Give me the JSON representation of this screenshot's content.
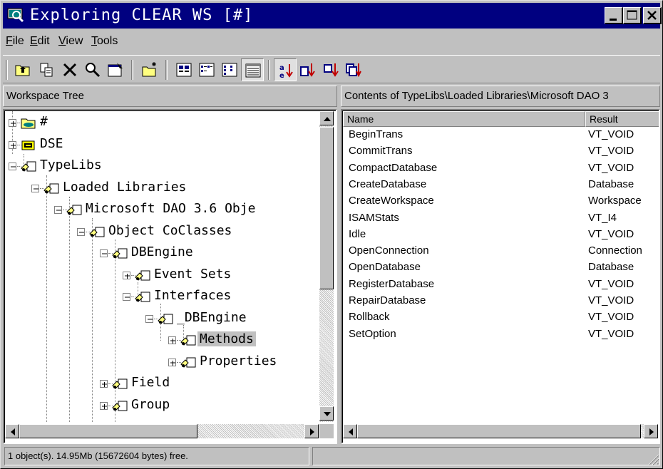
{
  "window": {
    "title": "Exploring CLEAR WS [#]",
    "title_bar_color": "#000080",
    "controls": [
      "minimize-icon",
      "maximize-icon",
      "close-icon"
    ]
  },
  "menu": [
    {
      "label": "File",
      "accel": "F",
      "rest": "ile"
    },
    {
      "label": "Edit",
      "accel": "E",
      "rest": "dit"
    },
    {
      "label": "View",
      "accel": "V",
      "rest": "iew"
    },
    {
      "label": "Tools",
      "accel": "T",
      "rest": "ools"
    }
  ],
  "toolbar": {
    "buttons": [
      "up-folder-icon",
      "copy-icon",
      "delete-icon",
      "find-icon",
      "properties-icon",
      "new-item-icon",
      "large-icons-icon",
      "small-icons-icon",
      "list-view-icon",
      "details-view-icon",
      "sort-az-icon",
      "sort-type-icon",
      "sort-size-icon",
      "sort-date-icon"
    ],
    "pressed": [
      "details-view-icon",
      "sort-az-icon"
    ]
  },
  "left_pane": {
    "header": "Workspace Tree",
    "tree": [
      {
        "label": "#",
        "level": 0,
        "expander": "plus",
        "icon": "folder-icon"
      },
      {
        "label": "DSE",
        "level": 0,
        "expander": "plus",
        "icon": "drive-icon"
      },
      {
        "label": "TypeLibs",
        "level": 0,
        "expander": "minus",
        "icon": "object-icon"
      },
      {
        "label": "Loaded Libraries",
        "level": 1,
        "expander": "minus",
        "icon": "object-icon"
      },
      {
        "label": "Microsoft DAO 3.6 Obje",
        "level": 2,
        "expander": "minus",
        "icon": "object-icon"
      },
      {
        "label": "Object CoClasses",
        "level": 3,
        "expander": "minus",
        "icon": "object-icon"
      },
      {
        "label": "DBEngine",
        "level": 4,
        "expander": "minus",
        "icon": "object-icon"
      },
      {
        "label": "Event Sets",
        "level": 5,
        "expander": "plus",
        "icon": "object-icon"
      },
      {
        "label": "Interfaces",
        "level": 5,
        "expander": "minus",
        "icon": "object-icon"
      },
      {
        "label": "_DBEngine",
        "level": 6,
        "expander": "minus",
        "icon": "object-icon"
      },
      {
        "label": "Methods",
        "level": 7,
        "expander": "plus",
        "icon": "object-icon",
        "selected": true
      },
      {
        "label": "Properties",
        "level": 7,
        "expander": "plus",
        "icon": "object-icon"
      },
      {
        "label": "Field",
        "level": 4,
        "expander": "plus",
        "icon": "object-icon"
      },
      {
        "label": "Group",
        "level": 4,
        "expander": "plus",
        "icon": "object-icon"
      }
    ]
  },
  "right_pane": {
    "header": "Contents of TypeLibs\\Loaded Libraries\\Microsoft DAO 3",
    "columns": [
      "Name",
      "Result"
    ],
    "rows": [
      [
        "BeginTrans",
        "VT_VOID"
      ],
      [
        "CommitTrans",
        "VT_VOID"
      ],
      [
        "CompactDatabase",
        "VT_VOID"
      ],
      [
        "CreateDatabase",
        "Database"
      ],
      [
        "CreateWorkspace",
        "Workspace"
      ],
      [
        "ISAMStats",
        "VT_I4"
      ],
      [
        "Idle",
        "VT_VOID"
      ],
      [
        "OpenConnection",
        "Connection"
      ],
      [
        "OpenDatabase",
        "Database"
      ],
      [
        "RegisterDatabase",
        "VT_VOID"
      ],
      [
        "RepairDatabase",
        "VT_VOID"
      ],
      [
        "Rollback",
        "VT_VOID"
      ],
      [
        "SetOption",
        "VT_VOID"
      ]
    ]
  },
  "status": {
    "text": "1 object(s). 14.95Mb (15672604 bytes) free.",
    "second_panel": ""
  }
}
